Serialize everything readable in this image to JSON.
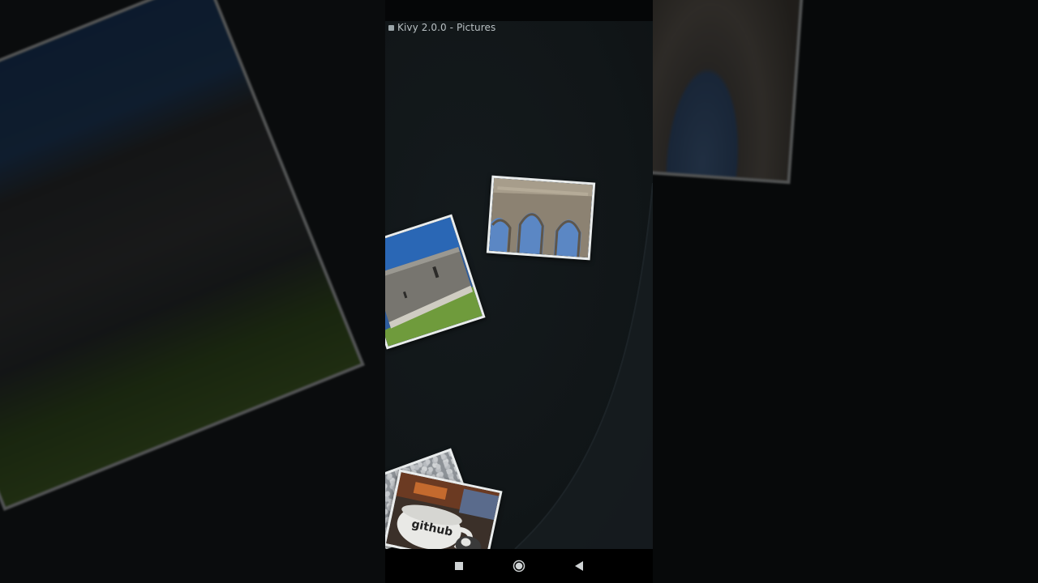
{
  "window": {
    "title": "Kivy 2.0.0 - Pictures"
  },
  "pictures": [
    {
      "subject": "castle rooftop with flags",
      "kind": "photo"
    },
    {
      "subject": "gothic abbey arches",
      "kind": "photo"
    },
    {
      "subject": "pebble texture",
      "kind": "photo"
    },
    {
      "subject": "github mug and cat",
      "kind": "photo",
      "visible_text": "github"
    }
  ],
  "nav": {
    "items": [
      "recents-square-icon",
      "home-circle-icon",
      "back-triangle-icon"
    ]
  },
  "colors": {
    "app_background": "#111618",
    "frame_border": "#e9ecec",
    "title_text": "#b9c0c3",
    "nav_icon": "#cfd3d4"
  }
}
